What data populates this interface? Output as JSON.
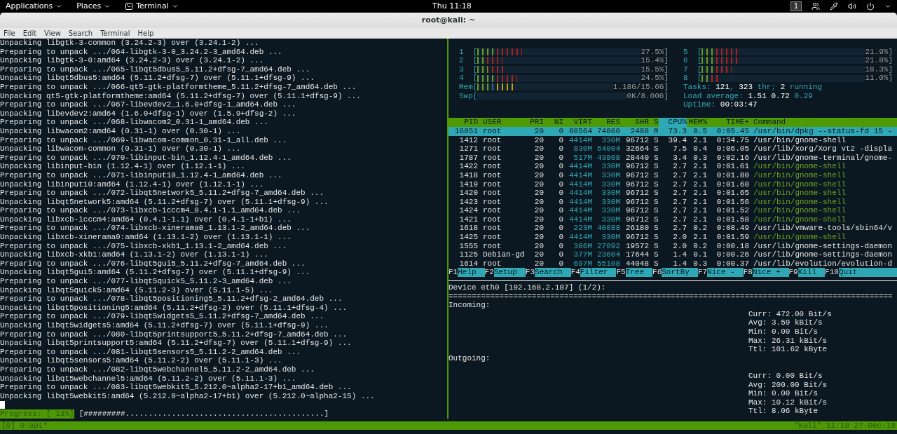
{
  "top_panel": {
    "menus": [
      {
        "label": "Applications",
        "kind": "menu"
      },
      {
        "label": "Places",
        "kind": "menu"
      },
      {
        "label": "Terminal",
        "kind": "app"
      }
    ],
    "clock": "Thu 11:18",
    "workspace": "1"
  },
  "window": {
    "title": "root@kali: ~",
    "menu": [
      "File",
      "Edit",
      "View",
      "Search",
      "Terminal",
      "Help"
    ]
  },
  "left_pane": {
    "lines": [
      "Unpacking libgtk-3-common (3.24.2-3) over (3.24.1-2) ...",
      "Preparing to unpack .../064-libgtk-3-0_3.24.2-3_amd64.deb ...",
      "Unpacking libgtk-3-0:amd64 (3.24.2-3) over (3.24.1-2) ...",
      "Preparing to unpack .../065-libqt5dbus5_5.11.2+dfsg-7_amd64.deb ...",
      "Unpacking libqt5dbus5:amd64 (5.11.2+dfsg-7) over (5.11.1+dfsg-9) ...",
      "Preparing to unpack .../066-qt5-gtk-platformtheme_5.11.2+dfsg-7_amd64.deb ...",
      "Unpacking qt5-gtk-platformtheme:amd64 (5.11.2+dfsg-7) over (5.11.1+dfsg-9) ...",
      "Preparing to unpack .../067-libevdev2_1.6.0+dfsg-1_amd64.deb ...",
      "Unpacking libevdev2:amd64 (1.6.0+dfsg-1) over (1.5.9+dfsg-2) ...",
      "Preparing to unpack .../068-libwacom2_0.31-1_amd64.deb ...",
      "Unpacking libwacom2:amd64 (0.31-1) over (0.30-1) ...",
      "Preparing to unpack .../069-libwacom-common_0.31-1_all.deb ...",
      "Unpacking libwacom-common (0.31-1) over (0.30-1) ...",
      "Preparing to unpack .../070-libinput-bin_1.12.4-1_amd64.deb ...",
      "Unpacking libinput-bin (1.12.4-1) over (1.12.1-1) ...",
      "Preparing to unpack .../071-libinput10_1.12.4-1_amd64.deb ...",
      "Unpacking libinput10:amd64 (1.12.4-1) over (1.12.1-1) ...",
      "Preparing to unpack .../072-libqt5network5_5.11.2+dfsg-7_amd64.deb ...",
      "Unpacking libqt5network5:amd64 (5.11.2+dfsg-7) over (5.11.1+dfsg-9) ...",
      "Preparing to unpack .../073-libxcb-icccm4_0.4.1-1.1_amd64.deb ...",
      "Unpacking libxcb-icccm4:amd64 (0.4.1-1.1) over (0.4.1-1+b1) ...",
      "Preparing to unpack .../074-libxcb-xinerama0_1.13.1-2_amd64.deb ...",
      "Unpacking libxcb-xinerama0:amd64 (1.13.1-2) over (1.13.1-1) ...",
      "Preparing to unpack .../075-libxcb-xkb1_1.13.1-2_amd64.deb ...",
      "Unpacking libxcb-xkb1:amd64 (1.13.1-2) over (1.13.1-1) ...",
      "Preparing to unpack .../076-libqt5gui5_5.11.2+dfsg-7_amd64.deb ...",
      "Unpacking libqt5gui5:amd64 (5.11.2+dfsg-7) over (5.11.1+dfsg-9) ...",
      "Preparing to unpack .../077-libqt5quick5_5.11.2-3_amd64.deb ...",
      "Unpacking libqt5quick5:amd64 (5.11.2-3) over (5.11.1-5) ...",
      "Preparing to unpack .../078-libqt5positioning5_5.11.2+dfsg-2_amd64.deb ...",
      "Unpacking libqt5positioning5:amd64 (5.11.2+dfsg-2) over (5.11.1+dfsg-4) ...",
      "Preparing to unpack .../079-libqt5widgets5_5.11.2+dfsg-7_amd64.deb ...",
      "Unpacking libqt5widgets5:amd64 (5.11.2+dfsg-7) over (5.11.1+dfsg-9) ...",
      "Preparing to unpack .../080-libqt5printsupport5_5.11.2+dfsg-7_amd64.deb ...",
      "Unpacking libqt5printsupport5:amd64 (5.11.2+dfsg-7) over (5.11.1+dfsg-9) ...",
      "Preparing to unpack .../081-libqt5sensors5_5.11.2-2_amd64.deb ...",
      "Unpacking libqt5sensors5:amd64 (5.11.2-2) over (5.11.1-3) ...",
      "Preparing to unpack .../082-libqt5webchannel5_5.11.2-2_amd64.deb ...",
      "Unpacking libqt5webchannel5:amd64 (5.11.2-2) over (5.11.1-3) ...",
      "Preparing to unpack .../083-libqt5webkit5_5.212.0~alpha2-17+b1_amd64.deb ...",
      "Unpacking libqt5webkit5:amd64 (5.212.0~alpha2-17+b1) over (5.212.0~alpha2-15) ..."
    ],
    "progress_label": "Progress: [ 13%]",
    "progress_bar": "[#########...........................................]"
  },
  "htop": {
    "meters_left": [
      {
        "kind": "cpu",
        "label": "1  [",
        "level": 0.275,
        "reading": "27.5%]"
      },
      {
        "kind": "cpu",
        "label": "2  [",
        "level": 0.154,
        "reading": "15.4%]"
      },
      {
        "kind": "cpu",
        "label": "3  [",
        "level": 0.155,
        "reading": "15.5%]"
      },
      {
        "kind": "cpu",
        "label": "4  [",
        "level": 0.245,
        "reading": "24.5%]"
      },
      {
        "kind": "mem",
        "label": "Mem[",
        "level": 0.28,
        "reading": "1.18G/15.6G]"
      },
      {
        "kind": "swap",
        "label": "Swp[",
        "level": 0,
        "reading": "0K/8.00G]"
      }
    ],
    "meters_right": [
      {
        "kind": "cpu",
        "label": "5  [",
        "level": 0.219,
        "reading": "21.9%]"
      },
      {
        "kind": "cpu",
        "label": "6  [",
        "level": 0.218,
        "reading": "21.8%]"
      },
      {
        "kind": "cpu",
        "label": "7  [",
        "level": 0.183,
        "reading": "18.3%]"
      },
      {
        "kind": "cpu",
        "label": "8  [",
        "level": 0.11,
        "reading": "11.0%]"
      }
    ],
    "summary": [
      "Tasks: **121**, **323** thr; **2** running",
      "Load average: **1.51** **0.72** 0.29",
      "Uptime: **00:03:47**"
    ],
    "columns": [
      {
        "label": "PID",
        "sorted": false
      },
      {
        "label": "USER",
        "sorted": false
      },
      {
        "label": "PRI",
        "sorted": false
      },
      {
        "label": "NI",
        "sorted": false
      },
      {
        "label": "VIRT",
        "sorted": false
      },
      {
        "label": "RES",
        "sorted": false
      },
      {
        "label": "SHR",
        "sorted": false
      },
      {
        "label": "S",
        "sorted": false
      },
      {
        "label": "CPU%",
        "sorted": true
      },
      {
        "label": "MEM%",
        "sorted": false
      },
      {
        "label": "TIME+",
        "sorted": false
      },
      {
        "label": "Command",
        "sorted": false
      }
    ],
    "rows": [
      {
        "selected": true,
        "thread": false,
        "cells": [
          "16051",
          "root",
          "20",
          "0",
          "80564",
          "74860",
          "2488",
          "R",
          "73.3",
          "0.5",
          "0:05.45",
          "/usr/bin/dpkg --status-fd 15 -"
        ]
      },
      {
        "selected": false,
        "thread": false,
        "cells": [
          "1412",
          "root",
          "20",
          "0",
          "4414M",
          "330M",
          "96712",
          "S",
          "39.4",
          "2.1",
          "0:34.75",
          "/usr/bin/gnome-shell"
        ]
      },
      {
        "selected": false,
        "thread": false,
        "cells": [
          "1271",
          "root",
          "20",
          "0",
          "830M",
          "64004",
          "32664",
          "S",
          "7.5",
          "0.4",
          "0:06.05",
          "/usr/lib/xorg/Xorg vt2 -displa"
        ]
      },
      {
        "selected": false,
        "thread": false,
        "cells": [
          "1787",
          "root",
          "20",
          "0",
          "517M",
          "43808",
          "28440",
          "S",
          "3.4",
          "0.3",
          "0:02.16",
          "/usr/lib/gnome-terminal/gnome-"
        ]
      },
      {
        "selected": false,
        "thread": true,
        "cells": [
          "1422",
          "root",
          "20",
          "0",
          "4414M",
          "330M",
          "96712",
          "S",
          "2.7",
          "2.1",
          "0:01.61",
          "/usr/bin/gnome-shell"
        ]
      },
      {
        "selected": false,
        "thread": true,
        "cells": [
          "1418",
          "root",
          "20",
          "0",
          "4414M",
          "330M",
          "96712",
          "S",
          "2.7",
          "2.1",
          "0:01.80",
          "/usr/bin/gnome-shell"
        ]
      },
      {
        "selected": false,
        "thread": true,
        "cells": [
          "1419",
          "root",
          "20",
          "0",
          "4414M",
          "330M",
          "96712",
          "S",
          "2.7",
          "2.1",
          "0:01.68",
          "/usr/bin/gnome-shell"
        ]
      },
      {
        "selected": false,
        "thread": true,
        "cells": [
          "1420",
          "root",
          "20",
          "0",
          "4414M",
          "330M",
          "96712",
          "S",
          "2.7",
          "2.1",
          "0:01.65",
          "/usr/bin/gnome-shell"
        ]
      },
      {
        "selected": false,
        "thread": true,
        "cells": [
          "1423",
          "root",
          "20",
          "0",
          "4414M",
          "330M",
          "96712",
          "S",
          "2.7",
          "2.1",
          "0:01.56",
          "/usr/bin/gnome-shell"
        ]
      },
      {
        "selected": false,
        "thread": true,
        "cells": [
          "1424",
          "root",
          "20",
          "0",
          "4414M",
          "330M",
          "96712",
          "S",
          "2.7",
          "2.1",
          "0:01.52",
          "/usr/bin/gnome-shell"
        ]
      },
      {
        "selected": false,
        "thread": true,
        "cells": [
          "1421",
          "root",
          "20",
          "0",
          "4414M",
          "330M",
          "96712",
          "S",
          "2.7",
          "2.1",
          "0:01.58",
          "/usr/bin/gnome-shell"
        ]
      },
      {
        "selected": false,
        "thread": false,
        "cells": [
          "1618",
          "root",
          "20",
          "0",
          "223M",
          "40088",
          "26180",
          "S",
          "2.7",
          "0.2",
          "0:08.49",
          "/usr/lib/vmware-tools/sbin64/v"
        ]
      },
      {
        "selected": false,
        "thread": true,
        "cells": [
          "1425",
          "root",
          "20",
          "0",
          "4414M",
          "330M",
          "96712",
          "S",
          "2.0",
          "2.1",
          "0:01.59",
          "/usr/bin/gnome-shell"
        ]
      },
      {
        "selected": false,
        "thread": false,
        "cells": [
          "1555",
          "root",
          "20",
          "0",
          "386M",
          "27092",
          "19572",
          "S",
          "2.0",
          "0.2",
          "0:00.18",
          "/usr/lib/gnome-settings-daemon"
        ]
      },
      {
        "selected": false,
        "thread": false,
        "cells": [
          "1125",
          "Debian-gd",
          "20",
          "0",
          "377M",
          "23604",
          "17644",
          "S",
          "1.4",
          "0.1",
          "0:00.26",
          "/usr/lib/gnome-settings-daemon"
        ]
      },
      {
        "selected": false,
        "thread": false,
        "cells": [
          "1614",
          "root",
          "20",
          "0",
          "697M",
          "55108",
          "44048",
          "S",
          "1.4",
          "0.3",
          "0:00.37",
          "/usr/lib/evolution/evolution-d"
        ]
      }
    ],
    "function_keys": [
      {
        "key": "F1",
        "action": "Help"
      },
      {
        "key": "F2",
        "action": "Setup"
      },
      {
        "key": "F3",
        "action": "Search"
      },
      {
        "key": "F4",
        "action": "Filter"
      },
      {
        "key": "F5",
        "action": "Tree"
      },
      {
        "key": "F6",
        "action": "SortBy"
      },
      {
        "key": "F7",
        "action": "Nice -"
      },
      {
        "key": "F8",
        "action": "Nice +"
      },
      {
        "key": "F9",
        "action": "Kill"
      },
      {
        "key": "F10",
        "action": "Quit"
      }
    ]
  },
  "nload": {
    "device": "Device eth0 [192.168.2.187] (1/2):",
    "separator": "================================================================================================",
    "sections": [
      {
        "title": "Incoming:",
        "stats": [
          "Curr: 472.00 Bit/s",
          "Avg: 3.59 kBit/s",
          "Min: 0.00 Bit/s",
          "Max: 26.31 kBit/s",
          "Ttl: 101.62 kByte"
        ]
      },
      {
        "title": "Outgoing:",
        "stats": [
          "Curr: 0.00 Bit/s",
          "Avg: 200.00 Bit/s",
          "Min: 0.00 Bit/s",
          "Max: 10.12 kBit/s",
          "Ttl: 8.06 kByte"
        ]
      }
    ]
  },
  "status_bar": {
    "left": "[0] 0:apt*",
    "right": "\"kali\" 11:18 27-Dec-18"
  }
}
